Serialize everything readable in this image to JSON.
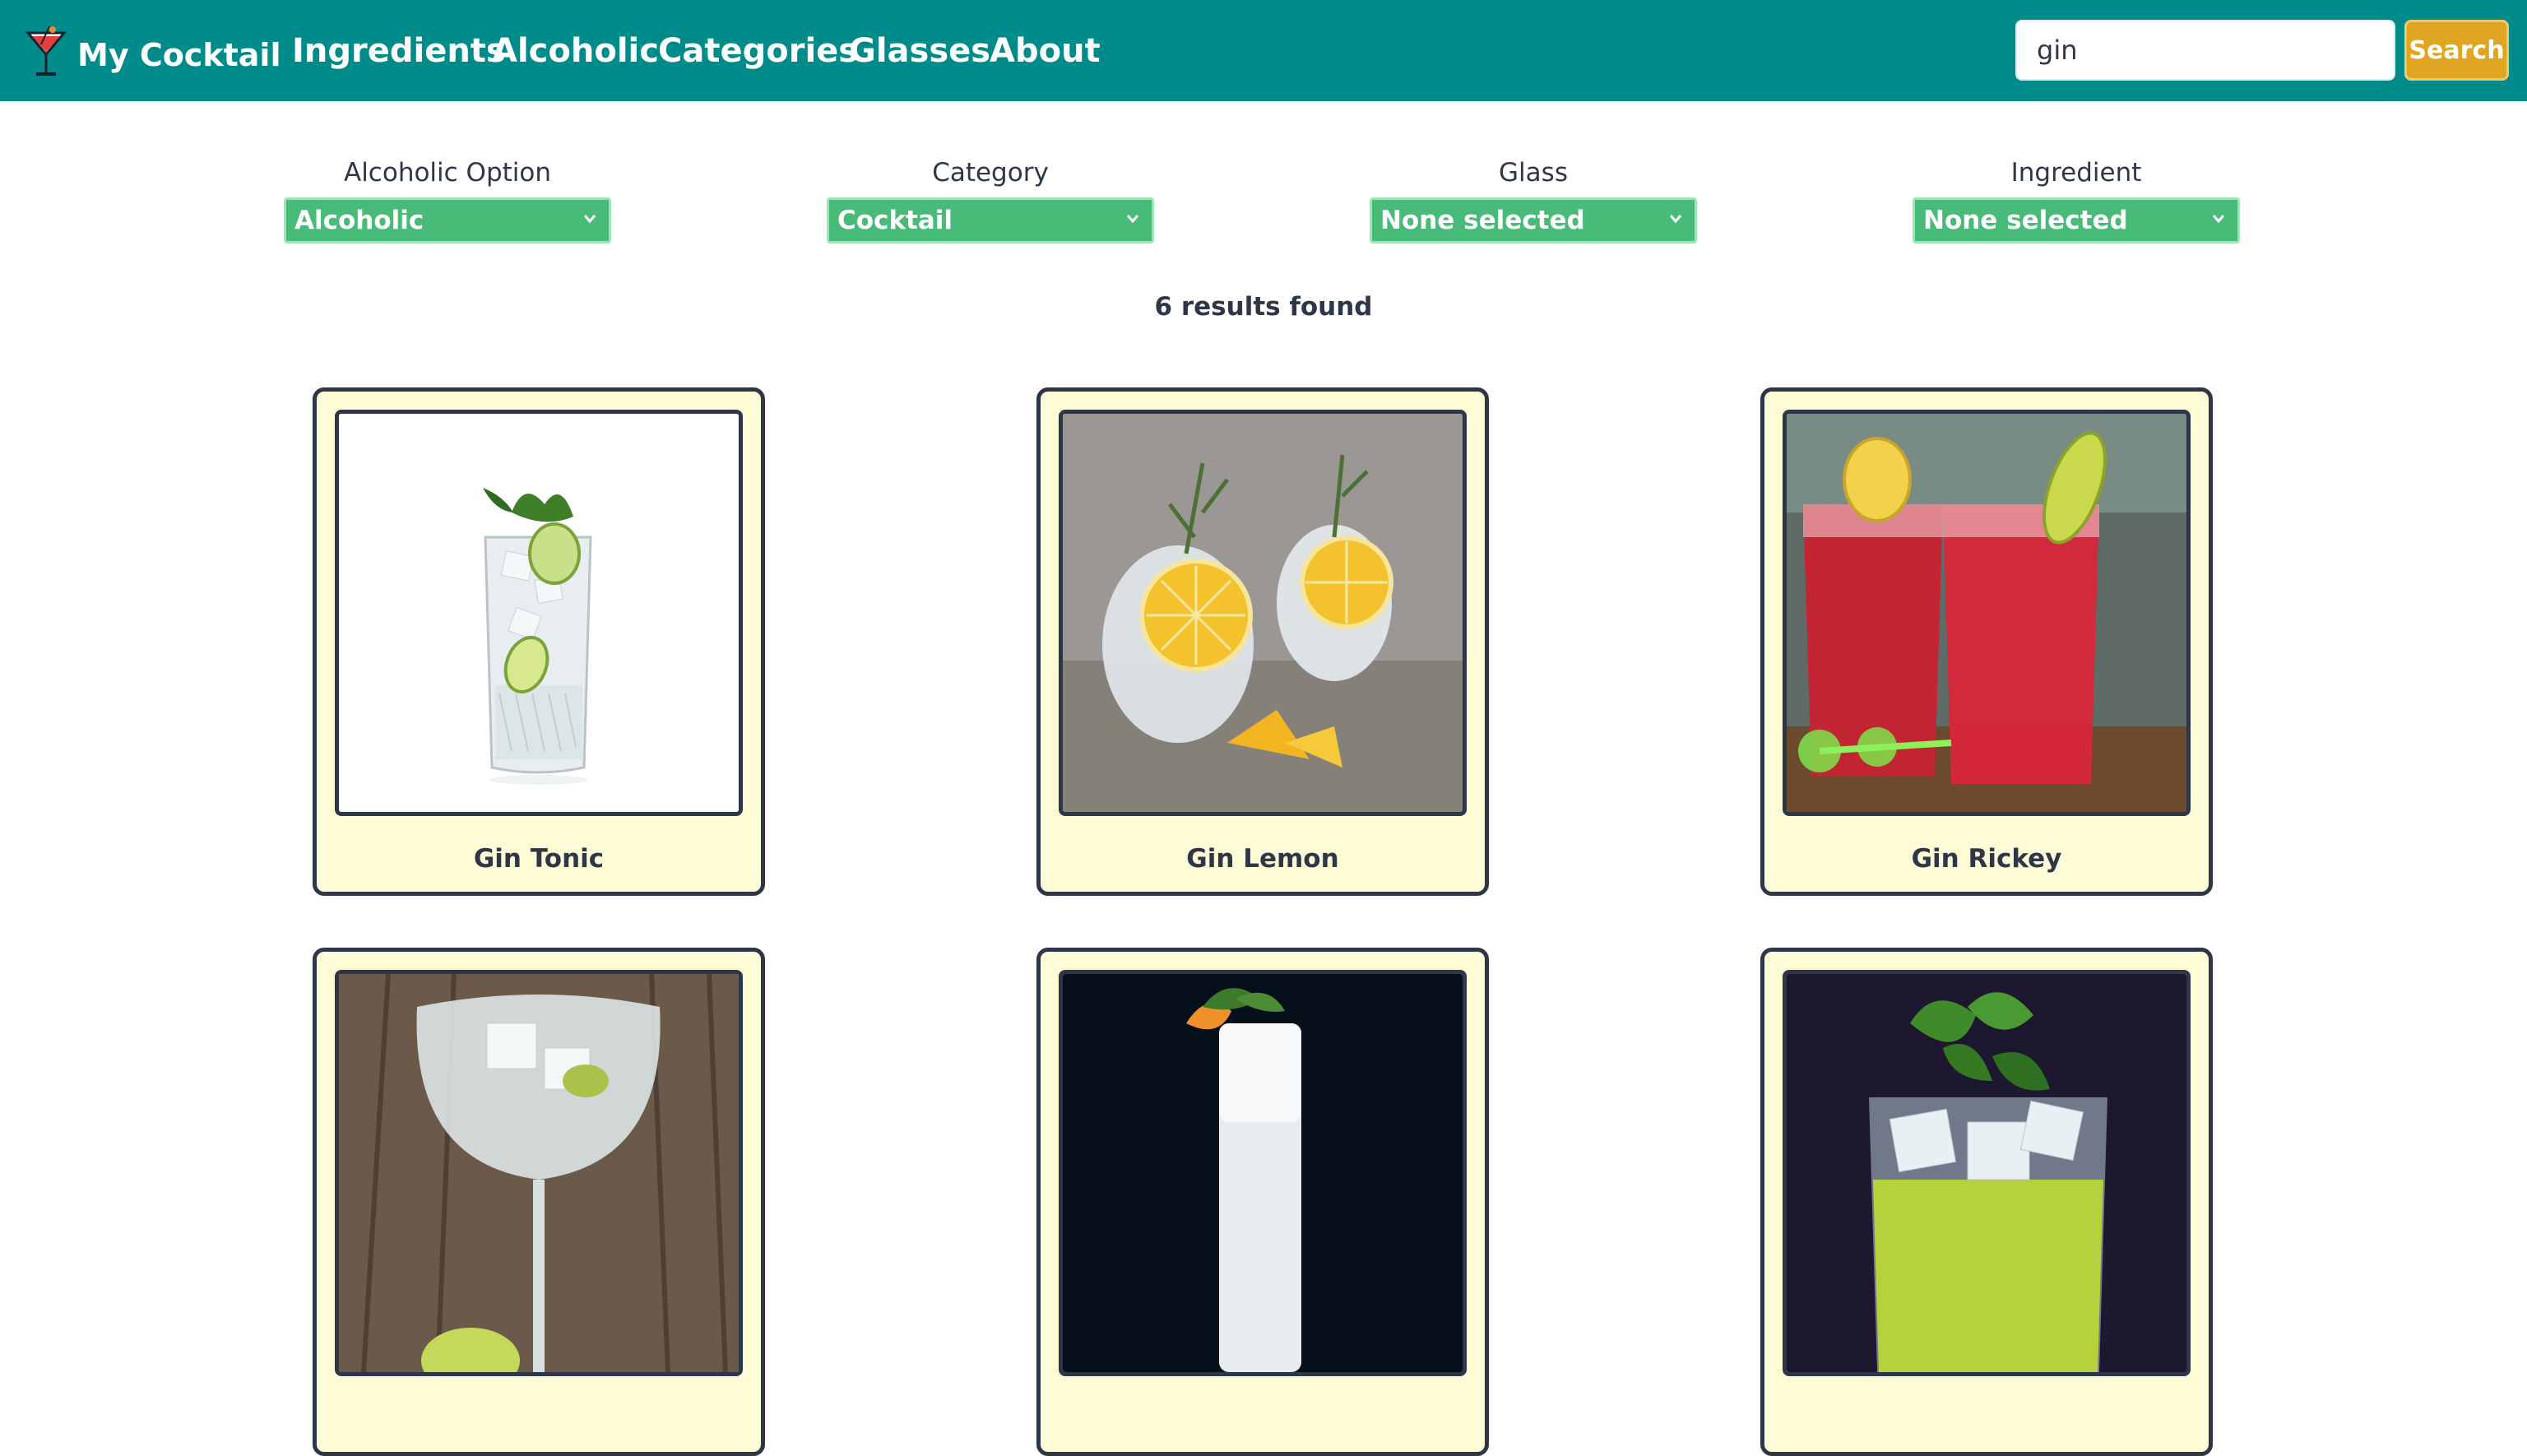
{
  "navbar": {
    "brand": "My Cocktail",
    "links": [
      "Ingredients",
      "Alcoholic",
      "Categories",
      "Glasses",
      "About"
    ],
    "search_value": "gin",
    "search_button": "Search",
    "background": "#008b8b",
    "search_button_color": "#e0a521"
  },
  "filters": [
    {
      "label": "Alcoholic Option",
      "selected": "Alcoholic"
    },
    {
      "label": "Category",
      "selected": "Cocktail"
    },
    {
      "label": "Glass",
      "selected": "None selected"
    },
    {
      "label": "Ingredient",
      "selected": "None selected"
    }
  ],
  "filter_color": "#48bb78",
  "results_text": "6 results found",
  "cards": [
    {
      "title": "Gin Tonic",
      "image": "highball-gin-tonic-lime-photo"
    },
    {
      "title": "Gin Lemon",
      "image": "two-glasses-lemon-slices-thyme-photo"
    },
    {
      "title": "Gin Rickey",
      "image": "red-highball-drinks-lemon-photo"
    },
    {
      "title": "",
      "image": "balloon-glass-gin-lime-wood-photo"
    },
    {
      "title": "",
      "image": "tall-white-fizz-orange-mint-photo"
    },
    {
      "title": "",
      "image": "green-drink-basil-ice-photo"
    }
  ],
  "card_background": "#fefcd7"
}
